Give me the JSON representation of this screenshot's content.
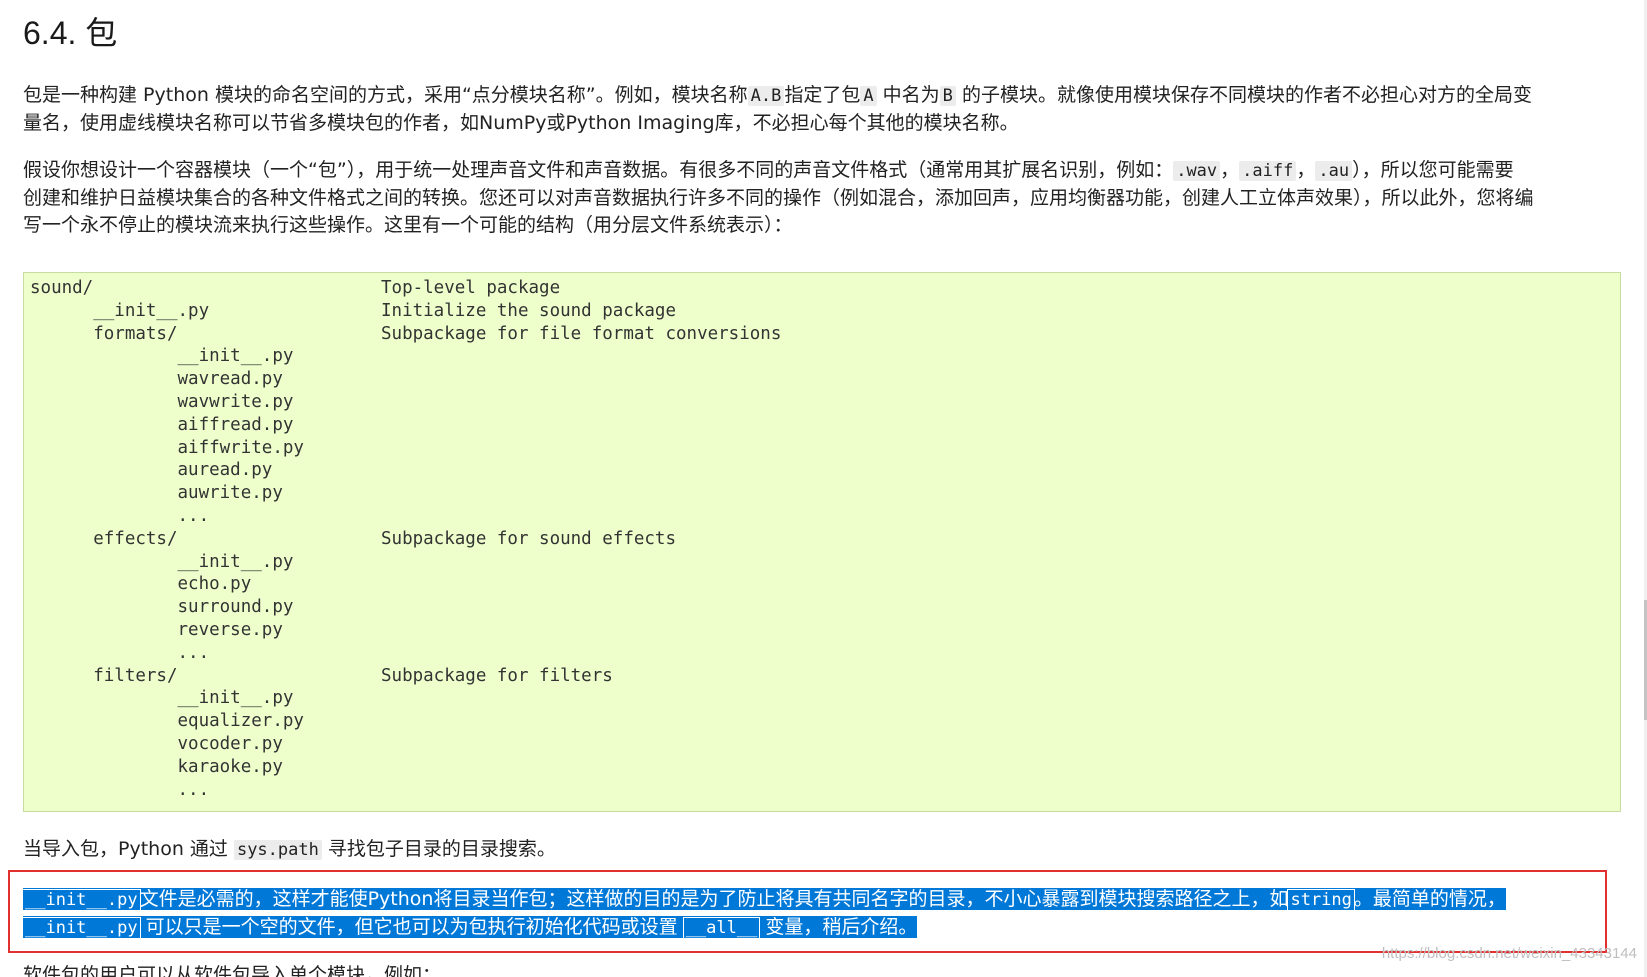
{
  "title": "6.4. 包",
  "para1": {
    "line1": {
      "t1": "包是一种构建 Python 模块的命名空间的方式，采用“点分模块名称”。例如，模块名称",
      "c1": "A.B",
      "t2": "指定了包",
      "c2": "A",
      "t3": " 中名为",
      "c3": "B",
      "t4": " 的子模块。就像使用模块保存不同模块的作者不必担心对方的全局变"
    },
    "line2": "量名，使用虚线模块名称可以节省多模块包的作者，如NumPy或Python Imaging库，不必担心每个其他的模块名称。"
  },
  "para2": {
    "line1": {
      "t1": "假设你想设计一个容器模块（一个“包”），用于统一处理声音文件和声音数据。有很多不同的声音文件格式（通常用其扩展名识别，例如：",
      "c1": ".wav",
      "t2": "，",
      "c2": ".aiff",
      "t3": "，",
      "c3": ".au",
      "t4": "），所以您可能需要"
    },
    "line2": "创建和维护日益模块集合的各种文件格式之间的转换。您还可以对声音数据执行许多不同的操作（例如混合，添加回声，应用均衡器功能，创建人工立体声效果），所以此外，您将编",
    "line3": "写一个永不停止的模块流来执行这些操作。这里有一个可能的结构（用分层文件系统表示）："
  },
  "code_lines": [
    {
      "path": "sound/",
      "desc": "Top-level package"
    },
    {
      "path": "      __init__.py",
      "desc": "Initialize the sound package"
    },
    {
      "path": "      formats/",
      "desc": "Subpackage for file format conversions"
    },
    {
      "path": "              __init__.py",
      "desc": ""
    },
    {
      "path": "              wavread.py",
      "desc": ""
    },
    {
      "path": "              wavwrite.py",
      "desc": ""
    },
    {
      "path": "              aiffread.py",
      "desc": ""
    },
    {
      "path": "              aiffwrite.py",
      "desc": ""
    },
    {
      "path": "              auread.py",
      "desc": ""
    },
    {
      "path": "              auwrite.py",
      "desc": ""
    },
    {
      "path": "              ...",
      "desc": ""
    },
    {
      "path": "      effects/",
      "desc": "Subpackage for sound effects"
    },
    {
      "path": "              __init__.py",
      "desc": ""
    },
    {
      "path": "              echo.py",
      "desc": ""
    },
    {
      "path": "              surround.py",
      "desc": ""
    },
    {
      "path": "              reverse.py",
      "desc": ""
    },
    {
      "path": "              ...",
      "desc": ""
    },
    {
      "path": "      filters/",
      "desc": "Subpackage for filters"
    },
    {
      "path": "              __init__.py",
      "desc": ""
    },
    {
      "path": "              equalizer.py",
      "desc": ""
    },
    {
      "path": "              vocoder.py",
      "desc": ""
    },
    {
      "path": "              karaoke.py",
      "desc": ""
    },
    {
      "path": "              ...",
      "desc": ""
    }
  ],
  "para3": {
    "t1": "当导入包，Python 通过 ",
    "c1": "sys.path",
    "t2": " 寻找包子目录的目录搜索。"
  },
  "para4": {
    "line1": {
      "c1": "__init__.py",
      "t1": "文件是必需的，这样才能使Python将目录当作包；这样做的目的是为了防止将具有共同名字的目录，不小心暴露到模块搜索路径之上，如",
      "c2": "string",
      "t2": "。最简单的情况，"
    },
    "line2": {
      "c1": "__init__.py",
      "t1": " 可以只是一个空的文件，但它也可以为包执行初始化代码或设置 ",
      "c2": "__all__",
      "t2": " 变量，稍后介绍。"
    }
  },
  "para5": "软件包的用户可以从软件包导入单个模块，例如：",
  "watermark": "https://blog.csdn.net/weixin_43343144",
  "colors": {
    "code_background": "#eeffcc",
    "selection": "#0078d7",
    "highlight_border": "#e03030"
  }
}
